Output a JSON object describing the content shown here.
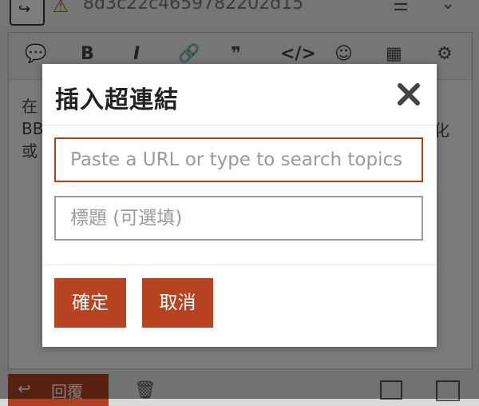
{
  "background": {
    "topic_title": "8d3c22c4659782202d15",
    "editor_text_lines": [
      "在",
      "BB",
      "或"
    ],
    "editor_text_right": "化",
    "reply_button_label": "回覆"
  },
  "dialog": {
    "title": "插入超連結",
    "url_placeholder": "Paste a URL or type to search topics",
    "url_value": "",
    "title_placeholder": "標題 (可選填)",
    "title_value": "",
    "ok_label": "確定",
    "cancel_label": "取消"
  },
  "colors": {
    "accent": "#b84320",
    "focus_border": "#b83d18"
  }
}
